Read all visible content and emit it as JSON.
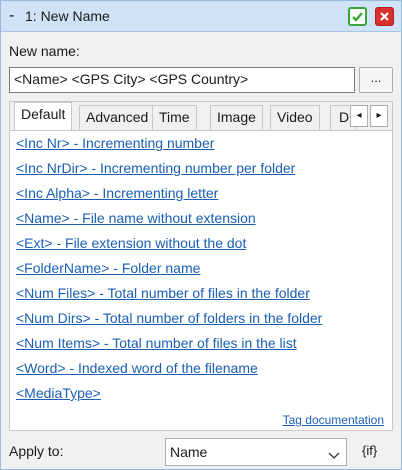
{
  "titlebar": {
    "collapse_glyph": "-",
    "title": "1: New Name"
  },
  "new_name": {
    "label": "New name:",
    "value": "<Name> <GPS City> <GPS Country>",
    "browse_label": "..."
  },
  "tabs": [
    {
      "label": "Default",
      "active": true
    },
    {
      "label": "Advanced",
      "active": false
    },
    {
      "label": "Time",
      "active": false
    },
    {
      "label": "Image",
      "active": false
    },
    {
      "label": "Video",
      "active": false
    },
    {
      "label": "D",
      "active": false
    }
  ],
  "tab_scroll": {
    "left": "◂",
    "right": "▸"
  },
  "tags": [
    "<Inc Nr> - Incrementing number",
    "<Inc NrDir> - Incrementing number per folder",
    "<Inc Alpha> - Incrementing letter",
    "<Name> - File name without extension",
    "<Ext> - File extension without the dot",
    "<FolderName> - Folder name",
    "<Num Files> - Total number of files in the folder",
    "<Num Dirs> - Total number of folders in the folder",
    "<Num Items> - Total number of files in the list",
    "<Word> - Indexed word of the filename",
    "<MediaType>"
  ],
  "doc_link": "Tag documentation",
  "apply": {
    "label": "Apply to:",
    "selected": "Name",
    "if_label": "{if}"
  },
  "colors": {
    "titlebar": "#cfe2f6",
    "link": "#1a5fb4",
    "ok": "#3aa63a",
    "close": "#d8302c"
  }
}
